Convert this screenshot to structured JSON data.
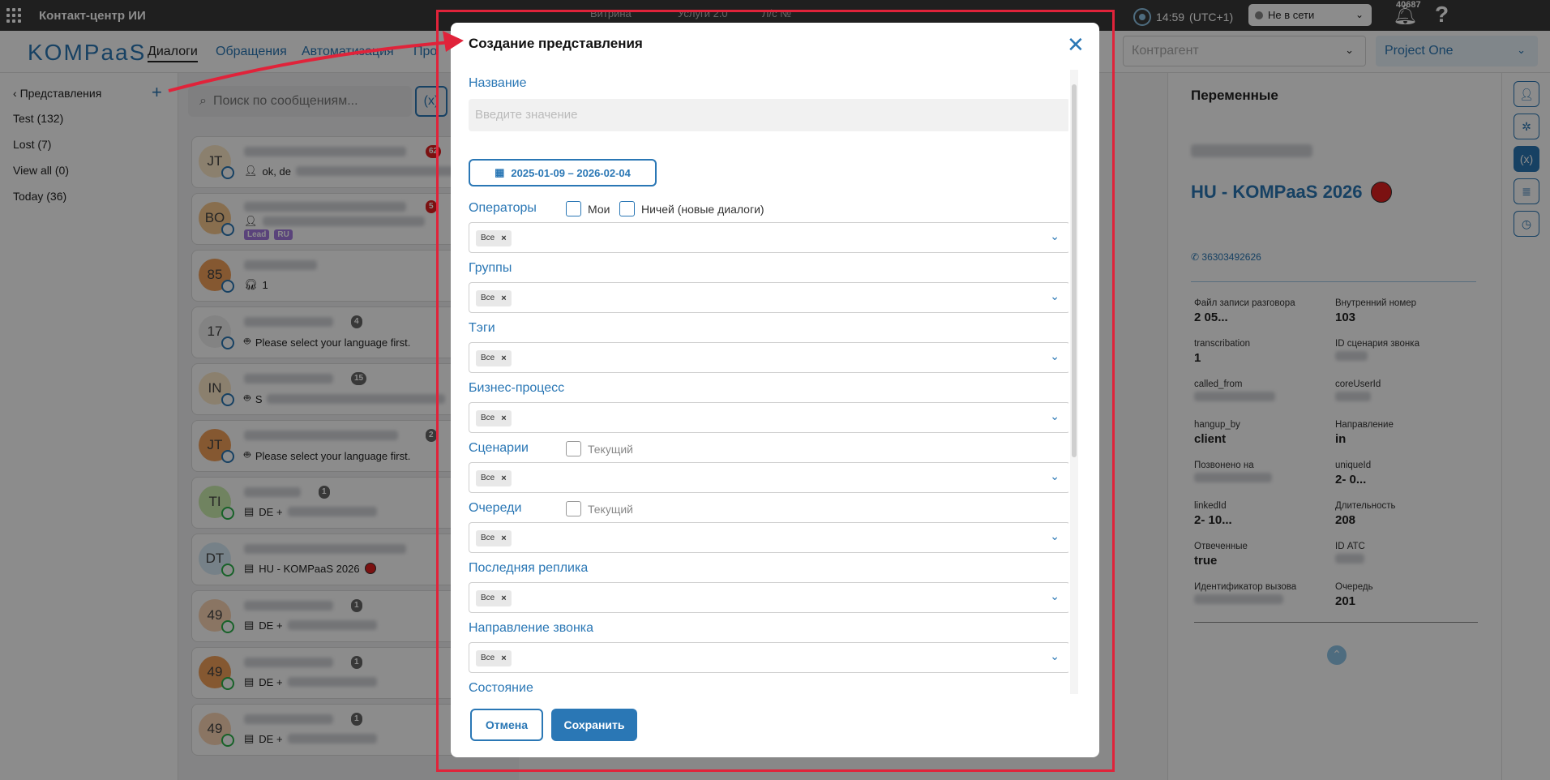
{
  "topbar": {
    "app_title": "Контакт-центр ИИ",
    "vitrina": "Витрина",
    "services": "Услуги 2.0",
    "account": "Л/с №",
    "time": "14:59",
    "timezone": "(UTC+1)",
    "status": "Не в сети",
    "notifications": "40687"
  },
  "header": {
    "logo": "KOMPaaS",
    "nav": [
      "Диалоги",
      "Обращения",
      "Автоматизация",
      "Про"
    ],
    "counterparty_placeholder": "Контрагент",
    "project": "Project One"
  },
  "views": {
    "back_label": "Представления",
    "items": [
      "Test (132)",
      "Lost (7)",
      "View all (0)",
      "Today (36)"
    ]
  },
  "search": {
    "placeholder": "Поиск по сообщениям..."
  },
  "dialogs": [
    {
      "initials": "JT",
      "badge": "62",
      "preview": "ok, de"
    },
    {
      "initials": "BO",
      "badge": "5",
      "tags": [
        "Lead",
        "RU"
      ]
    },
    {
      "initials": "85",
      "preview": "1"
    },
    {
      "initials": "17",
      "badge": "4",
      "preview": "Please select your language first."
    },
    {
      "initials": "IN",
      "badge": "15",
      "preview": "S"
    },
    {
      "initials": "JT",
      "badge": "2",
      "preview": "Please select your language first."
    },
    {
      "initials": "TI",
      "badge": "1",
      "preview": "DE +"
    },
    {
      "initials": "DT",
      "preview": "HU - KOMPaaS 2026"
    },
    {
      "initials": "49",
      "badge": "1",
      "preview": "DE +"
    },
    {
      "initials": "49",
      "badge": "1",
      "preview": "DE +"
    },
    {
      "initials": "49",
      "badge": "1",
      "preview": "DE +"
    }
  ],
  "variables": {
    "title": "Переменные",
    "contact_name": "HU - KOMPaaS 2026",
    "phone": "36303492626",
    "items": [
      {
        "label": "Файл записи разговора",
        "value": "2            05..."
      },
      {
        "label": "Внутренний номер",
        "value": "103"
      },
      {
        "label": "transcribation",
        "value": "1"
      },
      {
        "label": "ID сценария звонка",
        "value": ""
      },
      {
        "label": "called_from",
        "value": ""
      },
      {
        "label": "coreUserId",
        "value": ""
      },
      {
        "label": "hangup_by",
        "value": "client"
      },
      {
        "label": "Направление",
        "value": "in"
      },
      {
        "label": "Позвонено на",
        "value": ""
      },
      {
        "label": "uniqueId",
        "value": "2-            0..."
      },
      {
        "label": "linkedId",
        "value": "2-            10..."
      },
      {
        "label": "Длительность",
        "value": "208"
      },
      {
        "label": "Отвеченные",
        "value": "true"
      },
      {
        "label": "ID АТС",
        "value": ""
      },
      {
        "label": "Идентификатор вызова",
        "value": ""
      },
      {
        "label": "Очередь",
        "value": "201"
      }
    ]
  },
  "modal": {
    "title": "Создание представления",
    "name_label": "Название",
    "name_placeholder": "Введите значение",
    "date_range": "2025-01-09 – 2026-02-04",
    "chip_all": "Все",
    "operators_label": "Операторы",
    "mine": "Мои",
    "nobody": "Ничей (новые диалоги)",
    "groups_label": "Группы",
    "tags_label": "Тэги",
    "bp_label": "Бизнес-процесс",
    "scenarios_label": "Сценарии",
    "current": "Текущий",
    "queues_label": "Очереди",
    "last_reply_label": "Последняя реплика",
    "direction_label": "Направление звонка",
    "state_label": "Состояние",
    "cancel": "Отмена",
    "save": "Сохранить"
  },
  "colors": {
    "accent": "#2a77b5",
    "highlight": "#e0233a"
  }
}
